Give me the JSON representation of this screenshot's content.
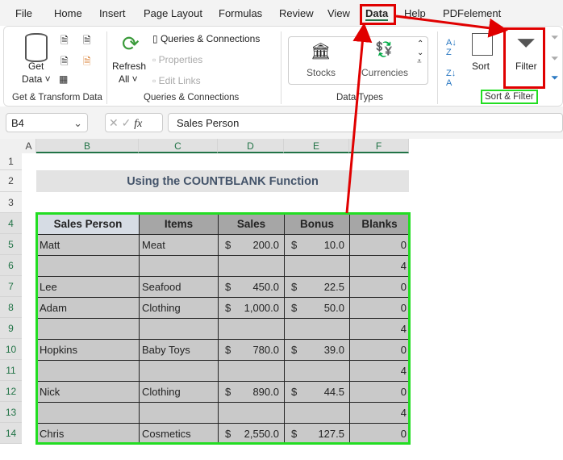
{
  "menu": [
    "File",
    "Home",
    "Insert",
    "Page Layout",
    "Formulas",
    "Review",
    "View",
    "Data",
    "Help",
    "PDFelement"
  ],
  "ribbon": {
    "get_data": "Get",
    "get_data2": "Data ˅",
    "group1": "Get & Transform Data",
    "refresh": "Refresh",
    "refresh2": "All ˅",
    "queries": "Queries & Connections",
    "properties": "Properties",
    "edit_links": "Edit Links",
    "group2": "Queries & Connections",
    "stocks": "Stocks",
    "currencies": "Currencies",
    "group3": "Data Types",
    "sort": "Sort",
    "filter": "Filter",
    "group4": "Sort & Filter"
  },
  "formula": {
    "name_box": "B4",
    "fx": "fx",
    "value": "Sales Person"
  },
  "columns": [
    "A",
    "B",
    "C",
    "D",
    "E",
    "F"
  ],
  "rows": [
    "1",
    "2",
    "3",
    "4",
    "5",
    "6",
    "7",
    "8",
    "9",
    "10",
    "11",
    "12",
    "13",
    "14"
  ],
  "title": "Using the COUNTBLANK Function",
  "table": {
    "headers": [
      "Sales Person",
      "Items",
      "Sales",
      "Bonus",
      "Blanks"
    ],
    "rows": [
      [
        "Matt",
        "Meat",
        "200.0",
        "10.0",
        "0"
      ],
      [
        "",
        "",
        "",
        "",
        "4"
      ],
      [
        "Lee",
        "Seafood",
        "450.0",
        "22.5",
        "0"
      ],
      [
        "Adam",
        "Clothing",
        "1,000.0",
        "50.0",
        "0"
      ],
      [
        "",
        "",
        "",
        "",
        "4"
      ],
      [
        "Hopkins",
        "Baby Toys",
        "780.0",
        "39.0",
        "0"
      ],
      [
        "",
        "",
        "",
        "",
        "4"
      ],
      [
        "Nick",
        "Clothing",
        "890.0",
        "44.5",
        "0"
      ],
      [
        "",
        "",
        "",
        "",
        "4"
      ],
      [
        "Chris",
        "Cosmetics",
        "2,550.0",
        "127.5",
        "0"
      ]
    ]
  },
  "currency": "$",
  "colors": {
    "accent": "#217346",
    "highlight_red": "#e00000",
    "highlight_green": "#22dd22"
  }
}
